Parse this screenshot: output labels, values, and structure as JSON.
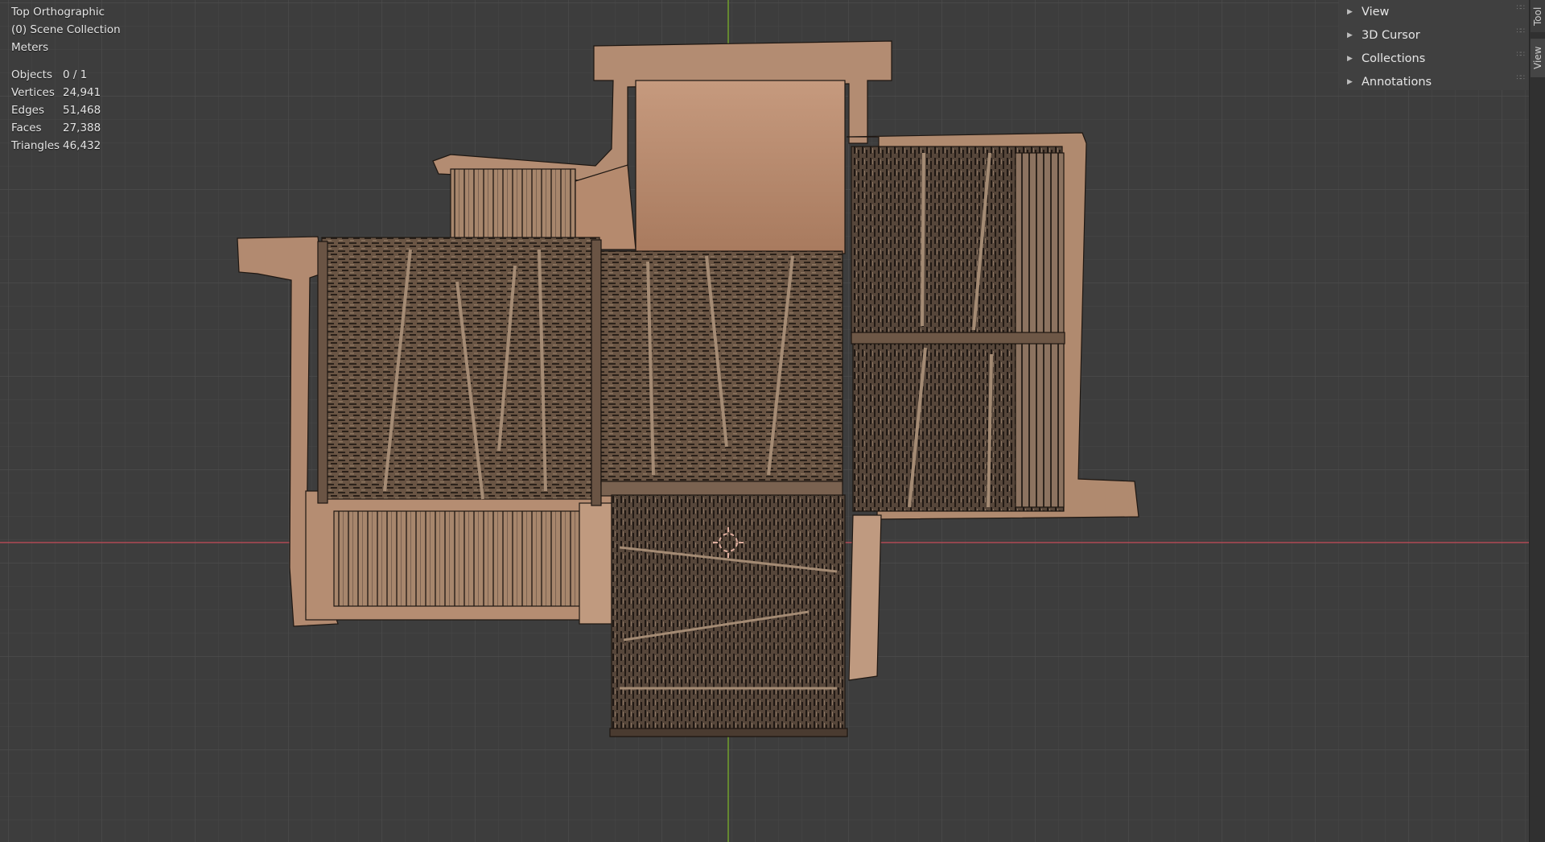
{
  "viewport": {
    "view_name": "Top Orthographic",
    "collection": "(0) Scene Collection",
    "units": "Meters"
  },
  "stats": [
    {
      "label": "Objects",
      "value": "0 / 1"
    },
    {
      "label": "Vertices",
      "value": "24,941"
    },
    {
      "label": "Edges",
      "value": "51,468"
    },
    {
      "label": "Faces",
      "value": "27,388"
    },
    {
      "label": "Triangles",
      "value": "46,432"
    }
  ],
  "sidebar_panels": [
    {
      "label": "View",
      "icon": "triangle-right-icon"
    },
    {
      "label": "3D Cursor",
      "icon": "triangle-right-icon"
    },
    {
      "label": "Collections",
      "icon": "triangle-right-icon"
    },
    {
      "label": "Annotations",
      "icon": "triangle-right-icon"
    }
  ],
  "side_tabs": {
    "tool": "Tool",
    "view": "View"
  },
  "colors": {
    "background": "#3d3d3d",
    "grid_minor": "#454545",
    "grid_major": "#4c4c4c",
    "x_axis": "#b04a55",
    "y_axis": "#6f9a2e",
    "roof_wood": "#6b5645",
    "roof_dark": "#2a211b",
    "plaster": "#b68a6f",
    "cursor": "#e0b0a0"
  }
}
